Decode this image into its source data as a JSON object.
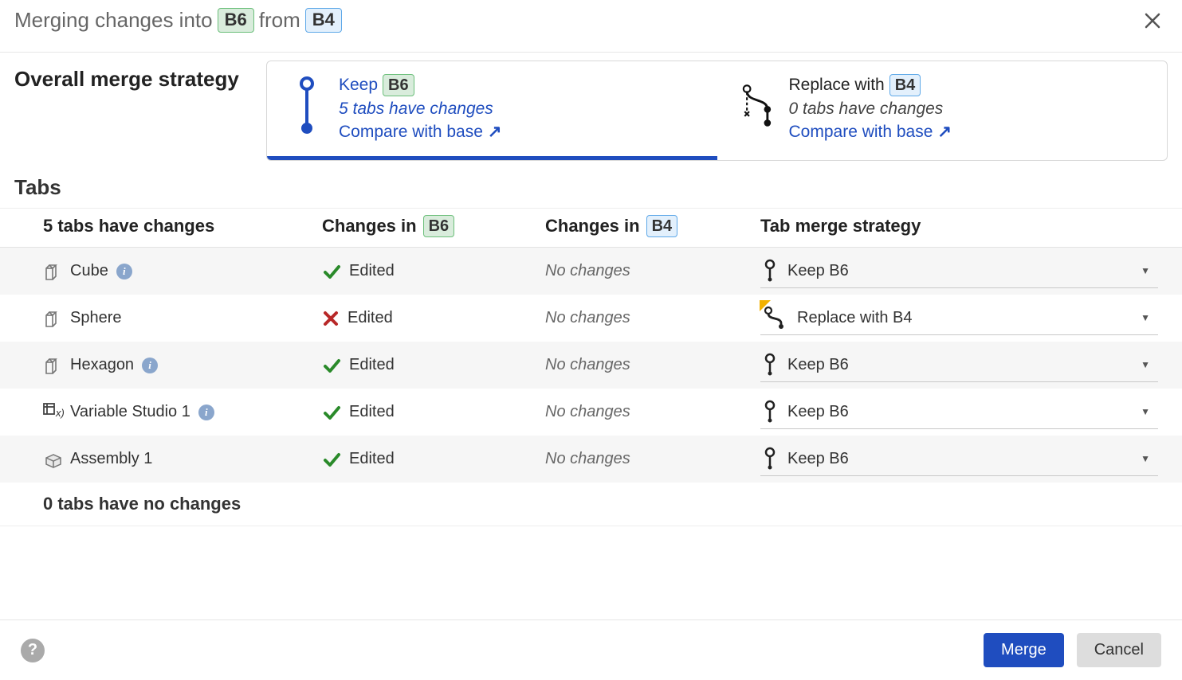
{
  "header": {
    "prefix": "Merging changes into",
    "target_branch": "B6",
    "middle": "from",
    "source_branch": "B4"
  },
  "overall": {
    "label": "Overall merge strategy",
    "keep": {
      "title": "Keep",
      "branch": "B6",
      "sub": "5 tabs have changes",
      "link": "Compare with base",
      "selected": true
    },
    "replace": {
      "title": "Replace with",
      "branch": "B4",
      "sub": "0 tabs have changes",
      "link": "Compare with base",
      "selected": false
    }
  },
  "tabs_section": {
    "heading": "Tabs",
    "columns": {
      "changes_summary": "5 tabs have changes",
      "changes_in_prefix": "Changes in",
      "target_branch": "B6",
      "source_branch": "B4",
      "strategy": "Tab merge strategy"
    },
    "rows": [
      {
        "name": "Cube",
        "icon": "part",
        "info": true,
        "target": {
          "status": "Edited",
          "ok": true
        },
        "source": "No changes",
        "strategy": {
          "label": "Keep B6",
          "icon": "keep",
          "flag": false
        }
      },
      {
        "name": "Sphere",
        "icon": "part",
        "info": false,
        "target": {
          "status": "Edited",
          "ok": false
        },
        "source": "No changes",
        "strategy": {
          "label": "Replace with B4",
          "icon": "replace",
          "flag": true
        }
      },
      {
        "name": "Hexagon",
        "icon": "part",
        "info": true,
        "target": {
          "status": "Edited",
          "ok": true
        },
        "source": "No changes",
        "strategy": {
          "label": "Keep B6",
          "icon": "keep",
          "flag": false
        }
      },
      {
        "name": "Variable Studio 1",
        "icon": "varstudio",
        "info": true,
        "target": {
          "status": "Edited",
          "ok": true
        },
        "source": "No changes",
        "strategy": {
          "label": "Keep B6",
          "icon": "keep",
          "flag": false
        }
      },
      {
        "name": "Assembly 1",
        "icon": "assembly",
        "info": false,
        "target": {
          "status": "Edited",
          "ok": true
        },
        "source": "No changes",
        "strategy": {
          "label": "Keep B6",
          "icon": "keep",
          "flag": false
        }
      }
    ],
    "no_changes_header": "0 tabs have no changes"
  },
  "footer": {
    "merge": "Merge",
    "cancel": "Cancel"
  }
}
